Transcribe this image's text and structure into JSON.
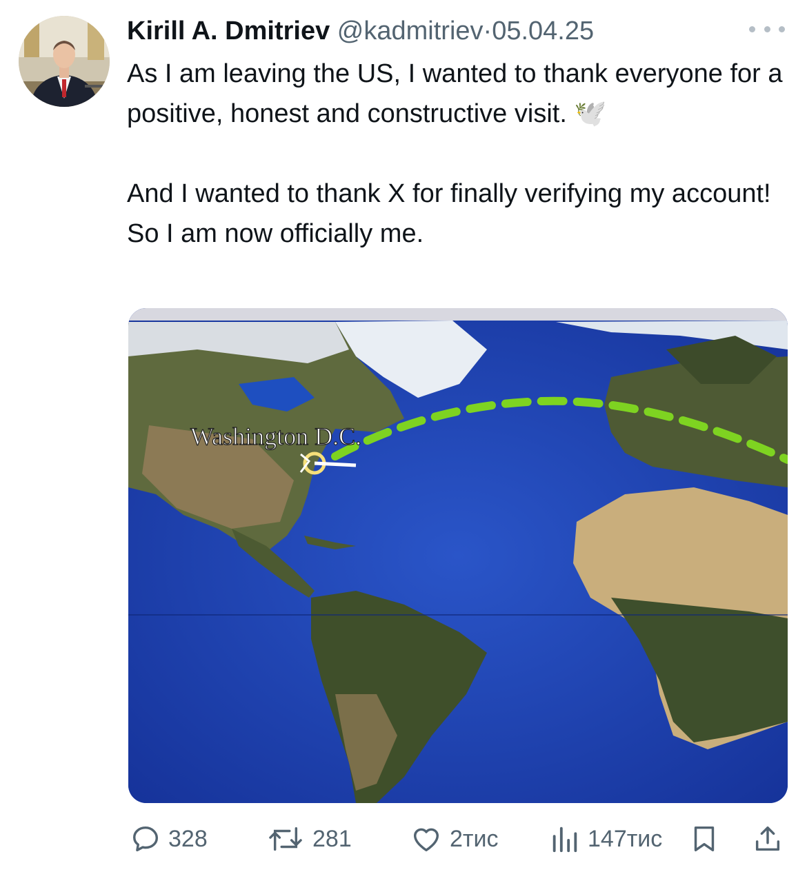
{
  "tweet": {
    "author_name": "Kirill A. Dmitriev",
    "handle": "@kadmitriev",
    "separator": "·",
    "date": "05.04.25",
    "paragraph1": "As I am leaving the US, I wanted to thank everyone for a positive, honest and constructive visit. 🕊️",
    "paragraph2": "And I wanted to thank X for finally verifying my account! So I am now officially me.",
    "media": {
      "map_label": "Washington D.C."
    }
  },
  "actions": {
    "replies": "328",
    "reposts": "281",
    "likes": "2тис",
    "views": "147тис"
  },
  "icons": {
    "avatar": "profile-photo",
    "more": "ellipsis-icon",
    "reply": "reply-icon",
    "repost": "repost-icon",
    "like": "heart-icon",
    "views": "views-chart-icon",
    "bookmark": "bookmark-icon",
    "share": "share-icon"
  },
  "colors": {
    "text": "#0f1419",
    "secondary": "#536471",
    "ocean": "#1a3fa6",
    "flight_path": "#7ed321"
  }
}
